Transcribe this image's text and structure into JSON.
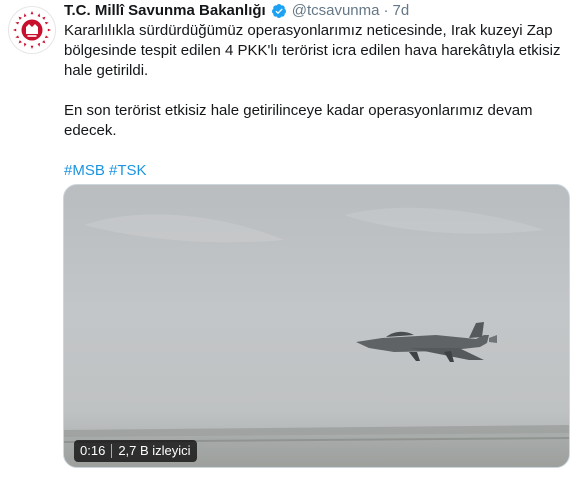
{
  "tweet": {
    "author_name": "T.C. Millî Savunma Bakanlığı",
    "handle": "@tcsavunma",
    "separator": "·",
    "time": "7d",
    "paragraph1": "Kararlılıkla sürdürdüğümüz operasyonlarımız neticesinde, Irak kuzeyi Zap bölgesinde tespit edilen 4 PKK'lı terörist icra edilen hava harekâtıyla etkisiz hale getirildi.",
    "paragraph2": "En son terörist etkisiz hale getirilinceye kadar operasyonlarımız devam edecek.",
    "hashtags": [
      "#MSB",
      "#TSK"
    ]
  },
  "video": {
    "duration": "0:16",
    "views": "2,7 B izleyici"
  },
  "icons": {
    "avatar": "msb-logo",
    "verified": "verified-badge-icon"
  },
  "colors": {
    "link": "#1b95e0",
    "secondary_text": "#657786",
    "verified_badge": "#1da1f2",
    "logo_red": "#c8102e"
  }
}
